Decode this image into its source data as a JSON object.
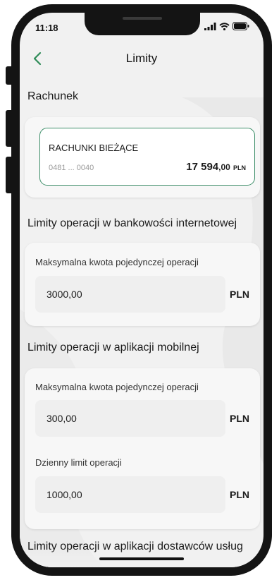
{
  "status_bar": {
    "time": "11:18"
  },
  "header": {
    "title": "Limity"
  },
  "account_section": {
    "label": "Rachunek",
    "account_name": "RACHUNKI BIEŻĄCE",
    "account_number": "0481 ... 0040",
    "balance_int": "17 594",
    "balance_dec": ",00",
    "balance_currency": "PLN"
  },
  "internet_limits": {
    "label": "Limity operacji w bankowości internetowej",
    "fields": [
      {
        "label": "Maksymalna kwota pojedynczej operacji",
        "value": "3000,00",
        "currency": "PLN"
      }
    ]
  },
  "mobile_limits": {
    "label": "Limity operacji w aplikacji mobilnej",
    "fields": [
      {
        "label": "Maksymalna kwota pojedynczej operacji",
        "value": "300,00",
        "currency": "PLN"
      },
      {
        "label": "Dzienny limit operacji",
        "value": "1000,00",
        "currency": "PLN"
      }
    ]
  },
  "provider_limits": {
    "label": "Limity operacji w aplikacji dostawców usług"
  },
  "colors": {
    "accent": "#3e8f6a",
    "back_arrow": "#2e8b57",
    "background": "#f1f1f1"
  },
  "icons": {
    "back": "chevron-left-icon",
    "signal": "signal-icon",
    "wifi": "wifi-icon",
    "battery": "battery-icon"
  }
}
